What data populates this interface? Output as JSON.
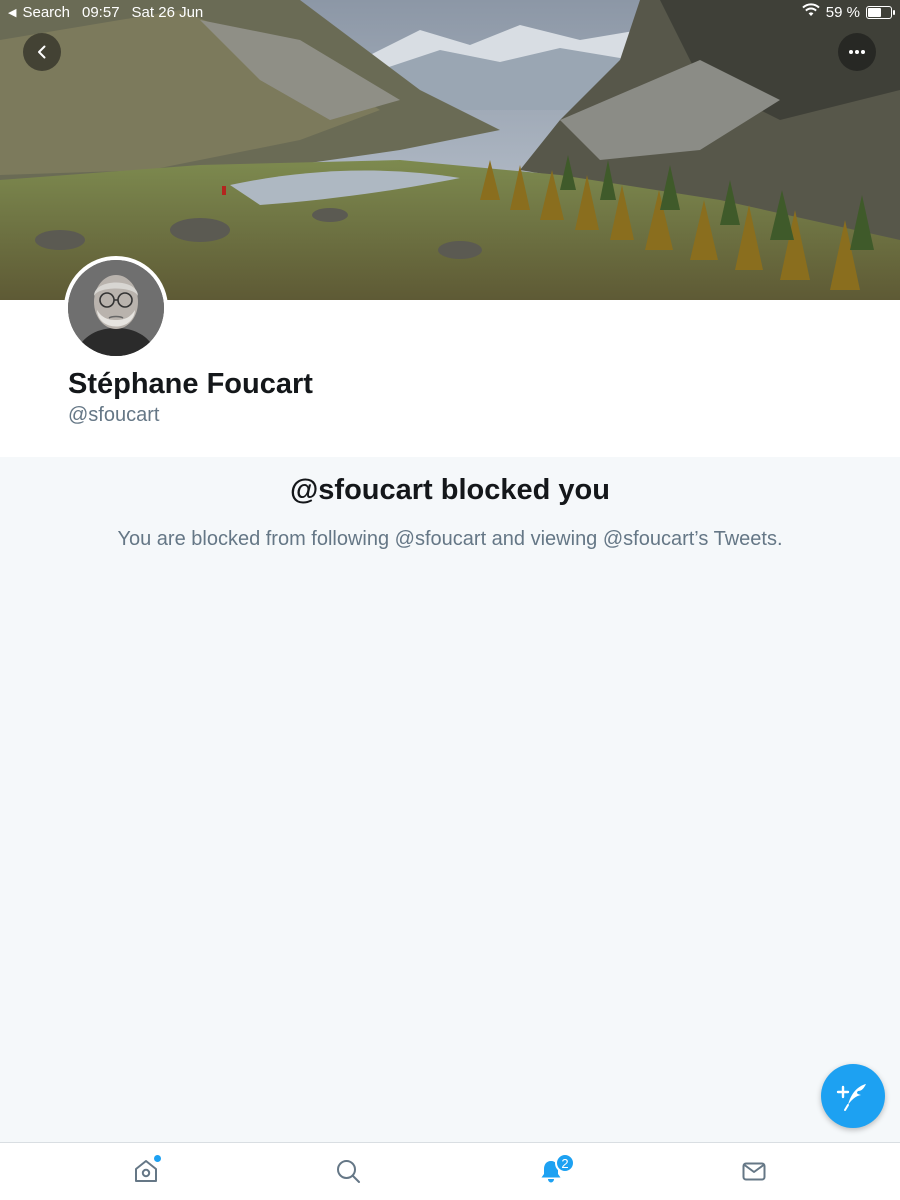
{
  "status_bar": {
    "back_app": "Search",
    "time": "09:57",
    "date": "Sat 26 Jun",
    "battery": "59 %",
    "battery_level": 0.59
  },
  "profile": {
    "display_name": "Stéphane Foucart",
    "handle": "@sfoucart"
  },
  "blocked": {
    "title": "@sfoucart blocked you",
    "description": "You are blocked from following @sfoucart and viewing @sfoucart’s Tweets."
  },
  "tab_bar": {
    "notifications_badge": "2"
  },
  "colors": {
    "accent": "#1da1f2",
    "background": "#f5f8fa",
    "secondary_text": "#657786",
    "primary_text": "#14171a"
  },
  "icons": [
    "back-arrow-icon",
    "more-icon",
    "compose-icon",
    "home-icon",
    "search-icon",
    "bell-icon",
    "mail-icon",
    "wifi-icon",
    "battery-icon"
  ]
}
